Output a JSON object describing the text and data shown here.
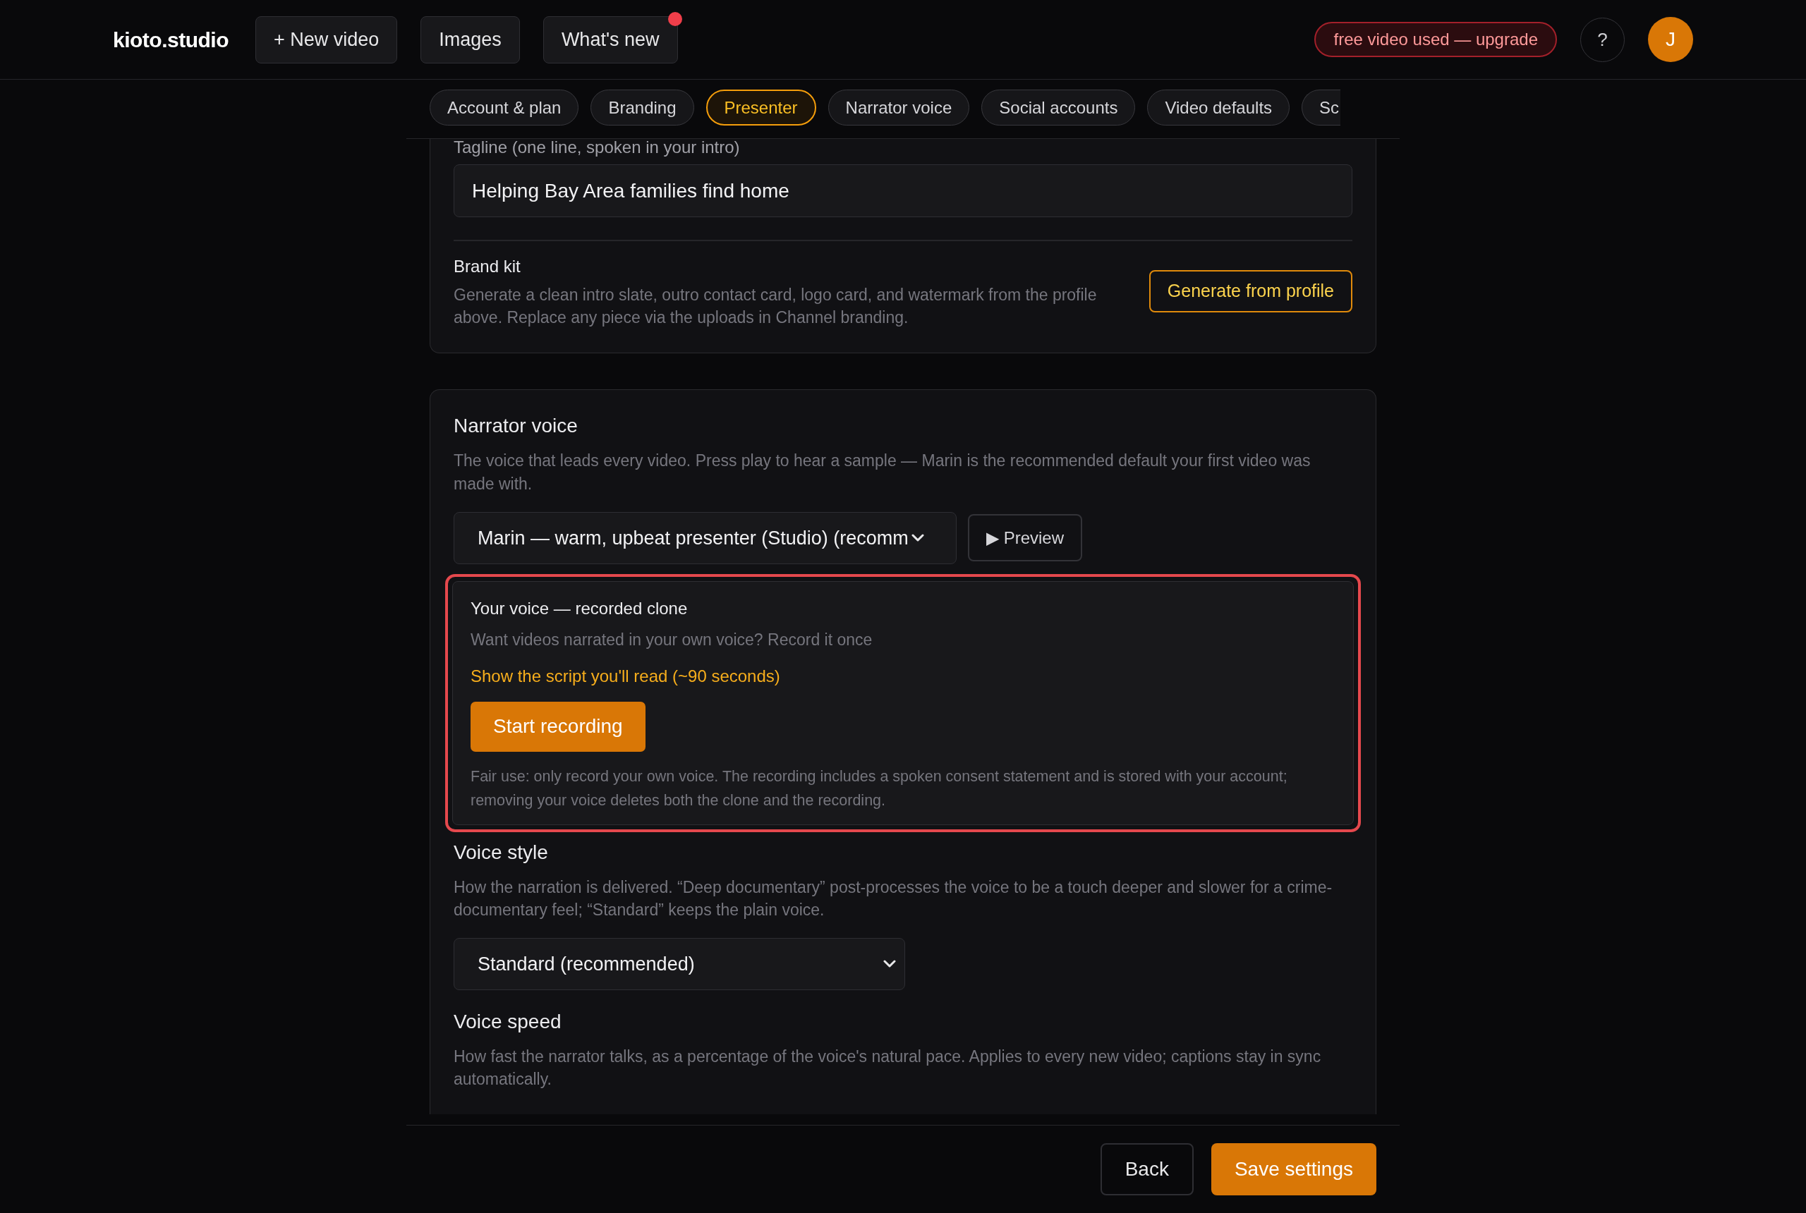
{
  "brand": "kioto.studio",
  "nav_buttons": [
    {
      "label": "+ New video",
      "notification": false
    },
    {
      "label": "Images",
      "notification": false
    },
    {
      "label": "What's new",
      "notification": true
    }
  ],
  "upgrade_badge": "free video used — upgrade",
  "help_button": "?",
  "avatar": "J",
  "tabs": [
    {
      "label": "Account & plan",
      "selected": false,
      "kind": "full"
    },
    {
      "label": "Branding",
      "selected": false,
      "kind": "full"
    },
    {
      "label": "Presenter",
      "selected": true,
      "kind": "full"
    },
    {
      "label": "Narrator voice",
      "selected": false,
      "kind": "full"
    },
    {
      "label": "Social accounts",
      "selected": false,
      "kind": "full"
    },
    {
      "label": "Video defaults",
      "selected": false,
      "kind": "full"
    },
    {
      "label": "Sc",
      "selected": false,
      "kind": "partial"
    }
  ],
  "brand_section": {
    "tagline": {
      "label": "Tagline (one line, spoken in your intro)",
      "value": "Helping Bay Area families find home"
    },
    "brand_kit": {
      "title": "Brand kit",
      "description": "Generate a clean intro slate, outro contact card, logo card, and watermark from the profile above. Replace any piece via the uploads in Channel branding.",
      "button": "Generate from profile"
    }
  },
  "narrator_section": {
    "title": "Narrator voice",
    "description": "The voice that leads every video. Press play to hear a sample — Marin is the recommended default your first video was made with.",
    "voice_select": "Marin — warm, upbeat presenter (Studio) (recomm",
    "preview_button": "▶ Preview",
    "clone": {
      "highlighted": true,
      "title": "Your voice — recorded clone",
      "description": "Want videos narrated in your own voice? Record it once",
      "script_link": "Show the script you'll read (~90 seconds)",
      "record_button": "Start recording",
      "fair_use": "Fair use: only record your own voice. The recording includes a spoken consent statement and is stored with your account; removing your voice deletes both the clone and the recording."
    },
    "voice_style": {
      "title": "Voice style",
      "description": "How the narration is delivered. “Deep documentary” post-processes the voice to be a touch deeper and slower for a crime-documentary feel; “Standard” keeps the plain voice.",
      "select": "Standard (recommended)"
    },
    "voice_speed": {
      "title": "Voice speed",
      "description": "How fast the narrator talks, as a percentage of the voice's natural pace. Applies to every new video; captions stay in sync automatically."
    }
  },
  "footer": {
    "back": "Back",
    "save": "Save settings"
  }
}
